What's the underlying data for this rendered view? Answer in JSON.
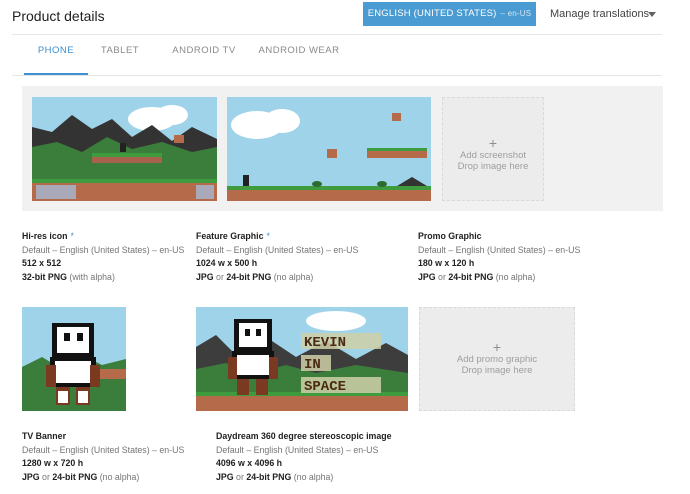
{
  "header": {
    "title": "Product details",
    "language_button": "ENGLISH (UNITED STATES)",
    "language_code": "– en-US",
    "manage_translations": "Manage translations"
  },
  "tabs": [
    {
      "label": "PHONE",
      "active": true
    },
    {
      "label": "TABLET",
      "active": false
    },
    {
      "label": "ANDROID TV",
      "active": false
    },
    {
      "label": "ANDROID WEAR",
      "active": false
    }
  ],
  "screenshots": {
    "add_title": "Add screenshot",
    "add_hint": "Drop image here"
  },
  "assets": {
    "hires": {
      "title": "Hi-res icon",
      "required_mark": "*",
      "locale": "Default – English (United States) – en-US",
      "size": "512 x 512",
      "format_bold": "32-bit PNG",
      "format_rest": " (with alpha)"
    },
    "feature": {
      "title": "Feature Graphic",
      "required_mark": "*",
      "locale": "Default – English (United States) – en-US",
      "size": "1024 w x 500 h",
      "format_a": "JPG",
      "format_or": " or ",
      "format_b": "24-bit PNG",
      "format_rest": " (no alpha)"
    },
    "promo": {
      "title": "Promo Graphic",
      "locale": "Default – English (United States) – en-US",
      "size": "180 w x 120 h",
      "format_a": "JPG",
      "format_or": " or ",
      "format_b": "24-bit PNG",
      "format_rest": " (no alpha)"
    },
    "tv": {
      "title": "TV Banner",
      "locale": "Default – English (United States) – en-US",
      "size": "1280 w x 720 h",
      "format_a": "JPG",
      "format_or": " or ",
      "format_b": "24-bit PNG",
      "format_rest": " (no alpha)"
    },
    "daydream": {
      "title": "Daydream 360 degree stereoscopic image",
      "locale": "Default – English (United States) – en-US",
      "size": "4096 w x 4096 h",
      "format_a": "JPG",
      "format_or": " or ",
      "format_b": "24-bit PNG",
      "format_rest": " (no alpha)"
    }
  },
  "promo_add": {
    "title": "Add promo graphic",
    "hint": "Drop image here"
  },
  "feature_image_text": [
    "KEVIN",
    "IN",
    "SPACE"
  ],
  "colors": {
    "accent": "#4a9bd1",
    "tab_active": "#3d8fcf",
    "sky": "#9fd3ea",
    "ground": "#b56a4a",
    "grass": "#3b8a3c",
    "mountain": "#3d3d3d"
  }
}
